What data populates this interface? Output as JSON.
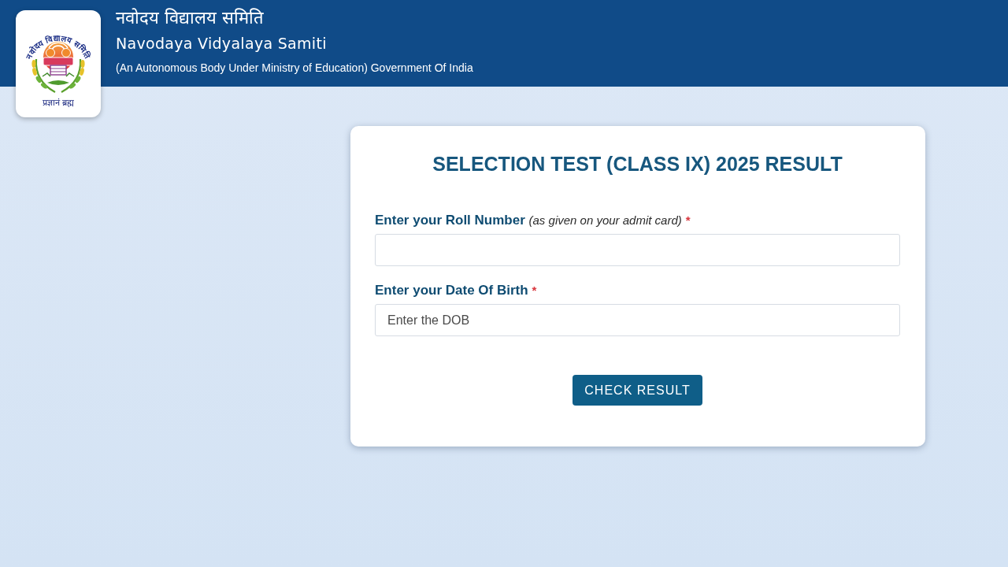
{
  "header": {
    "logo": {
      "arc_text": "नवोदय विद्यालय समिति",
      "motto": "प्रज्ञानं ब्रह्म"
    },
    "title_hindi": "नवोदय विद्यालय समिति",
    "title": "Navodaya Vidyalaya Samiti",
    "subtitle": "(An Autonomous Body Under Ministry of Education) Government Of India"
  },
  "form": {
    "title": "SELECTION TEST (CLASS IX) 2025 RESULT",
    "fields": [
      {
        "label": "Enter your Roll Number *(as given on your admit card)*",
        "required_mark": "*"
      },
      {
        "label": "Enter your Date Of Birth",
        "required_mark": "*",
        "placeholder": "Enter the DOB"
      }
    ],
    "submit_button": "CHECK RESULT"
  }
}
